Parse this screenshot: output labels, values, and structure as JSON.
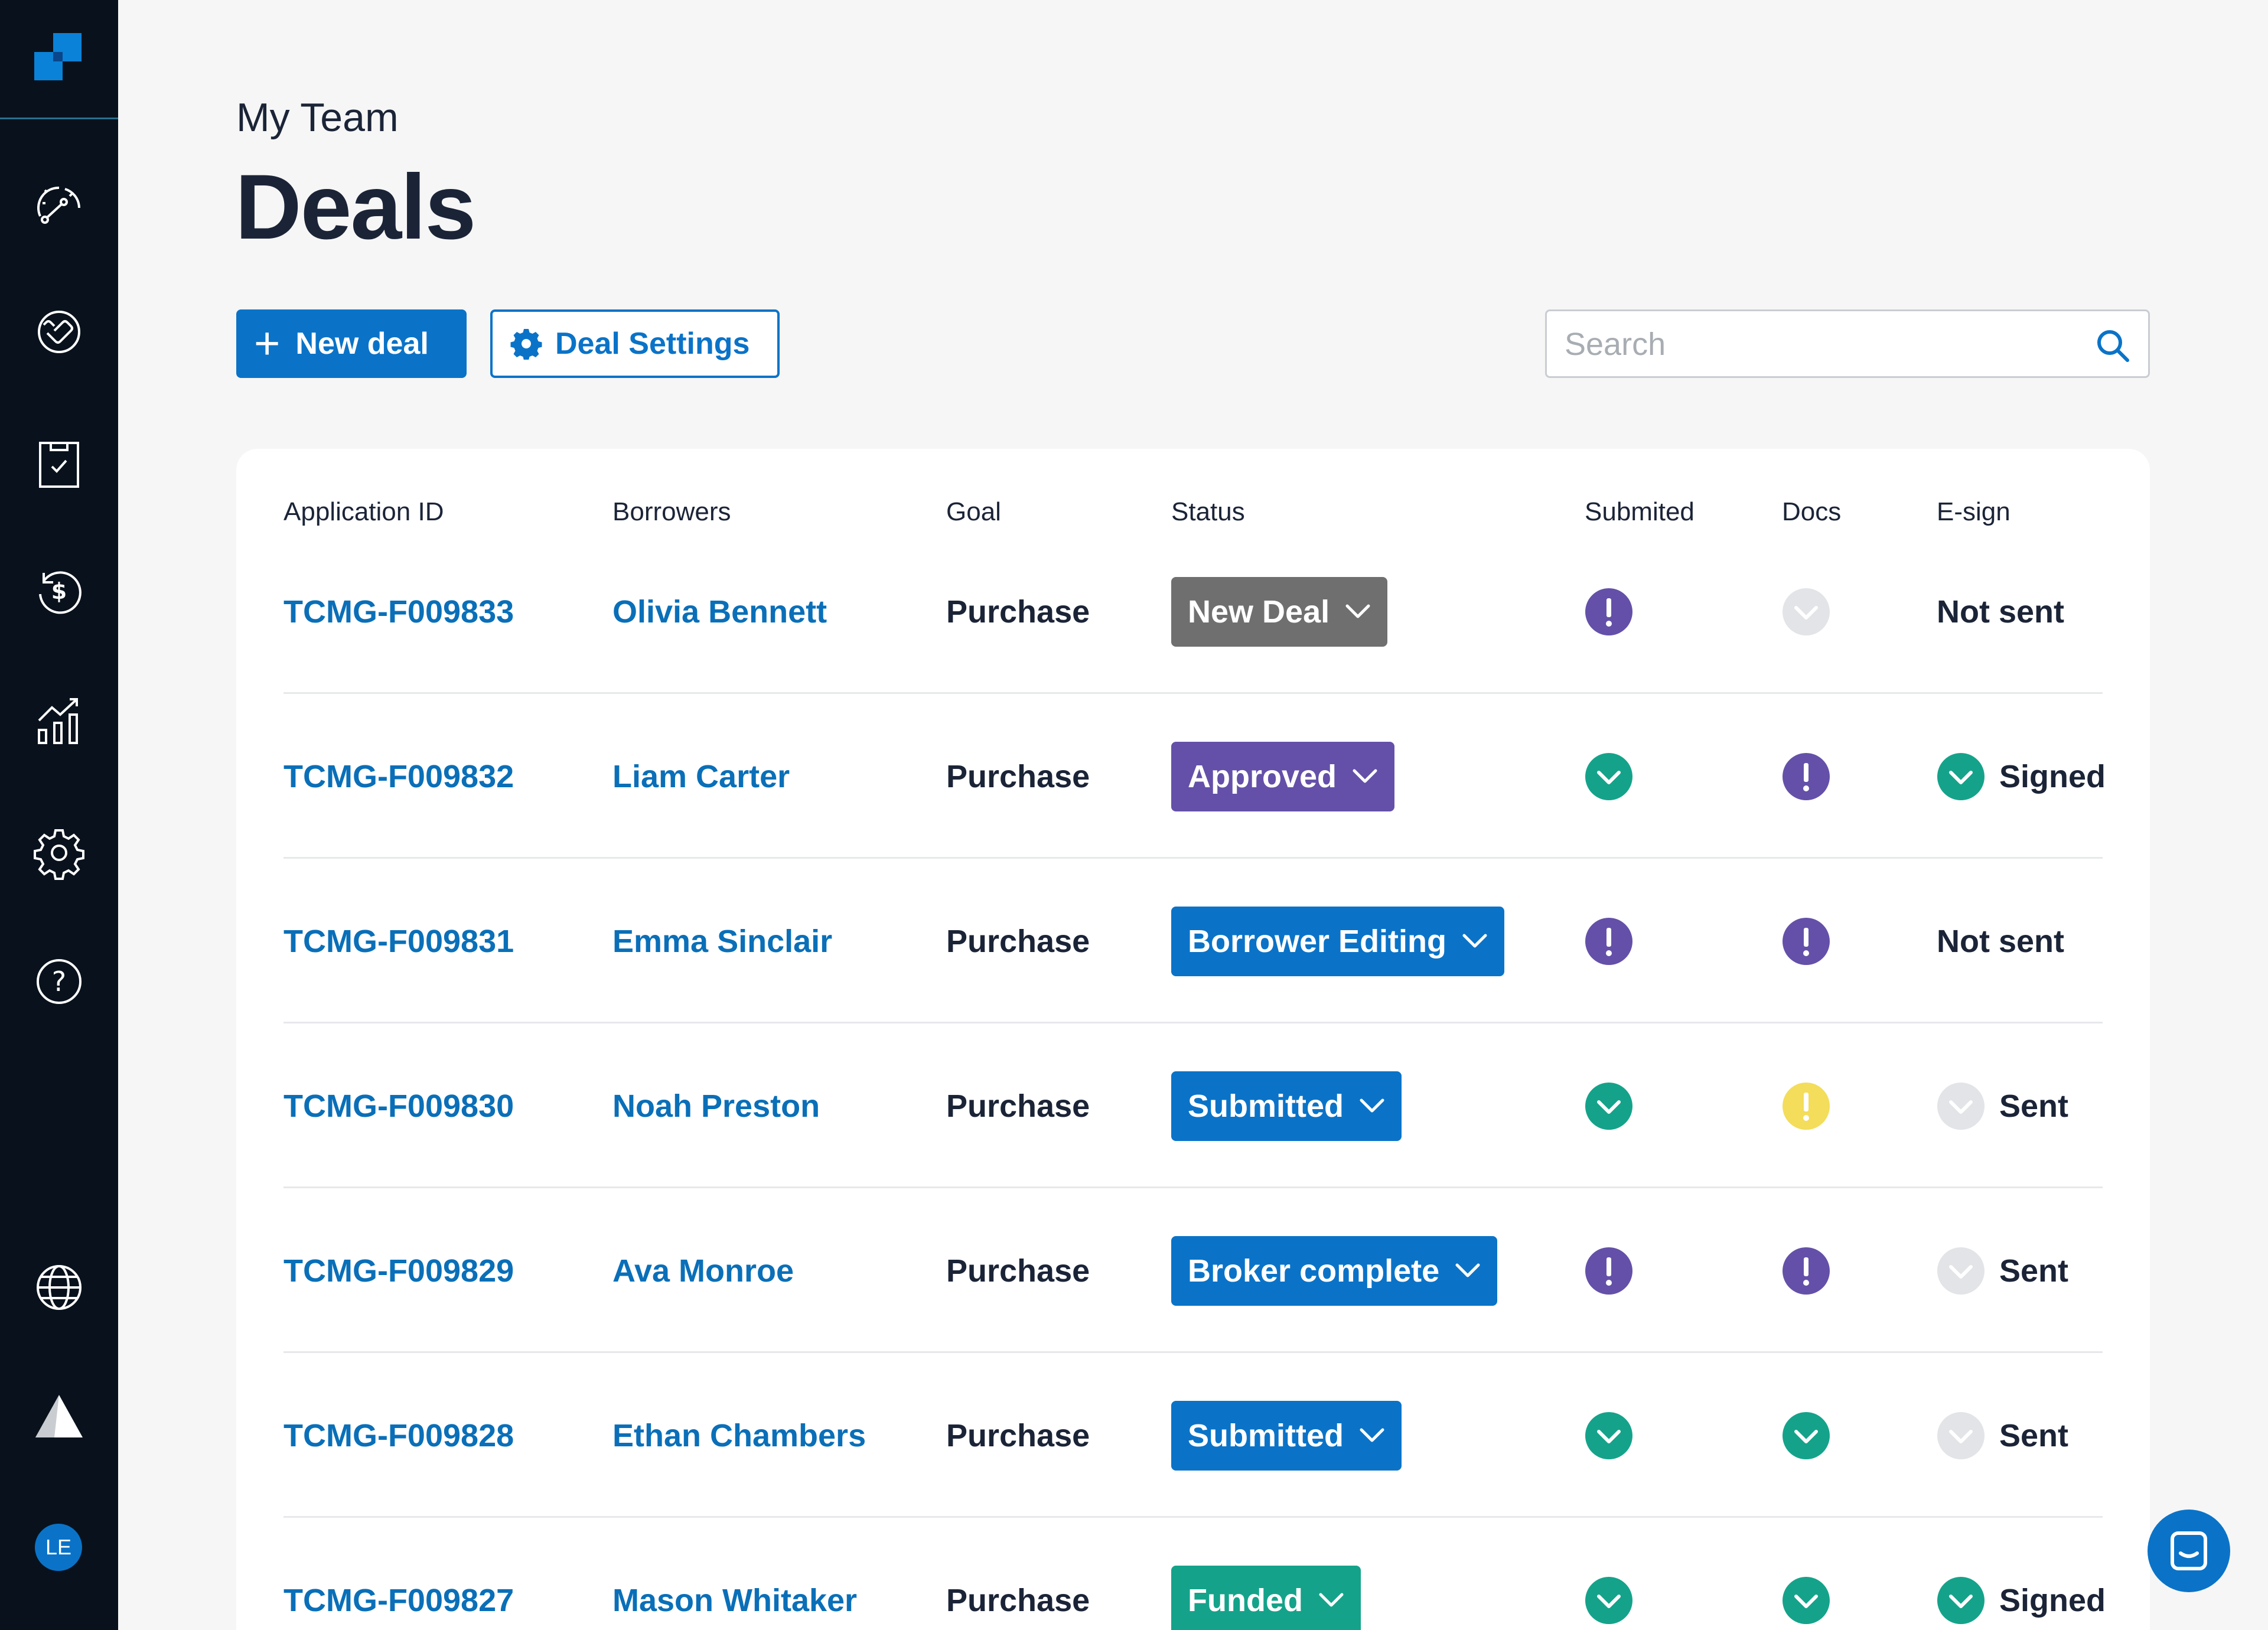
{
  "sidebar": {
    "logo": "app-logo",
    "nav": [
      {
        "name": "dashboard-icon"
      },
      {
        "name": "deals-handshake-icon"
      },
      {
        "name": "tasks-clipboard-icon"
      },
      {
        "name": "refinance-dollar-icon"
      },
      {
        "name": "reports-chart-icon"
      },
      {
        "name": "settings-gear-icon"
      },
      {
        "name": "help-question-icon"
      }
    ],
    "bottom": [
      {
        "name": "globe-icon"
      },
      {
        "name": "mountain-logo-icon"
      }
    ],
    "avatar_initials": "LE"
  },
  "header": {
    "subtitle": "My Team",
    "title": "Deals"
  },
  "toolbar": {
    "new_deal_label": "New deal",
    "new_deal_icon": "+",
    "settings_label": "Deal Settings"
  },
  "search": {
    "placeholder": "Search",
    "value": ""
  },
  "table": {
    "columns": [
      "Application ID",
      "Borrowers",
      "Goal",
      "Status",
      "Submited",
      "Docs",
      "E-sign"
    ],
    "rows": [
      {
        "id": "TCMG-F009833",
        "borrower": "Olivia Bennett",
        "goal": "Purchase",
        "status": "New Deal",
        "status_color": "#6f6f6f",
        "submitted": "alert-purple",
        "docs": "check-grey",
        "esign_icon": "none",
        "esign": "Not sent"
      },
      {
        "id": "TCMG-F009832",
        "borrower": "Liam Carter",
        "goal": "Purchase",
        "status": "Approved",
        "status_color": "#6450a8",
        "submitted": "check-green",
        "docs": "alert-purple",
        "esign_icon": "check-green",
        "esign": "Signed"
      },
      {
        "id": "TCMG-F009831",
        "borrower": "Emma Sinclair",
        "goal": "Purchase",
        "status": "Borrower Editing",
        "status_color": "#0a73c8",
        "submitted": "alert-purple",
        "docs": "alert-purple",
        "esign_icon": "none",
        "esign": "Not sent"
      },
      {
        "id": "TCMG-F009830",
        "borrower": "Noah Preston",
        "goal": "Purchase",
        "status": "Submitted",
        "status_color": "#0a73c8",
        "submitted": "check-green",
        "docs": "alert-yellow",
        "esign_icon": "check-grey",
        "esign": "Sent"
      },
      {
        "id": "TCMG-F009829",
        "borrower": "Ava Monroe",
        "goal": "Purchase",
        "status": "Broker complete",
        "status_color": "#0a73c8",
        "submitted": "alert-purple",
        "docs": "alert-purple",
        "esign_icon": "check-grey",
        "esign": "Sent"
      },
      {
        "id": "TCMG-F009828",
        "borrower": "Ethan Chambers",
        "goal": "Purchase",
        "status": "Submitted",
        "status_color": "#0a73c8",
        "submitted": "check-green",
        "docs": "check-green",
        "esign_icon": "check-grey",
        "esign": "Sent"
      },
      {
        "id": "TCMG-F009827",
        "borrower": "Mason Whitaker",
        "goal": "Purchase",
        "status": "Funded",
        "status_color": "#14a38a",
        "submitted": "check-green",
        "docs": "check-green",
        "esign_icon": "check-green",
        "esign": "Signed"
      }
    ]
  },
  "colors": {
    "brand": "#0a73c8",
    "check_green": "#14a38a",
    "alert_purple": "#6450a8",
    "alert_yellow": "#f3dd5a",
    "check_grey": "#e2e4e7"
  },
  "chat": {
    "icon": "chat-bubble-icon"
  }
}
